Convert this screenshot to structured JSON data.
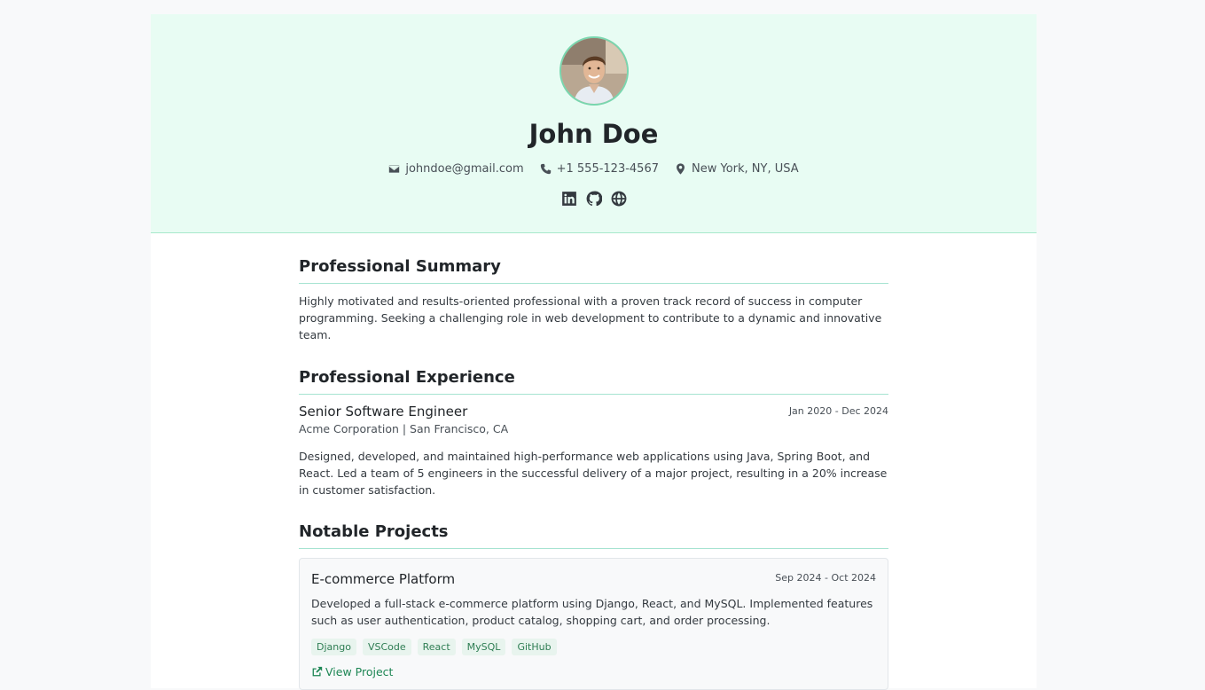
{
  "header": {
    "name": "John Doe",
    "email": "johndoe@gmail.com",
    "phone": "+1 555-123-4567",
    "location": "New York, NY, USA",
    "socials": [
      "linkedin-icon",
      "github-icon",
      "globe-icon"
    ]
  },
  "summary": {
    "title": "Professional Summary",
    "text": "Highly motivated and results-oriented professional with a proven track record of success in computer programming. Seeking a challenging role in web development to contribute to a dynamic and innovative team."
  },
  "experience": {
    "title": "Professional Experience",
    "jobs": [
      {
        "title": "Senior Software Engineer",
        "dates": "Jan 2020 - Dec 2024",
        "company": "Acme Corporation | San Francisco, CA",
        "description": "Designed, developed, and maintained high-performance web applications using Java, Spring Boot, and React. Led a team of 5 engineers in the successful delivery of a major project, resulting in a 20% increase in customer satisfaction."
      }
    ]
  },
  "projects": {
    "title": "Notable Projects",
    "items": [
      {
        "title": "E-commerce Platform",
        "dates": "Sep 2024 - Oct 2024",
        "description": "Developed a full-stack e-commerce platform using Django, React, and MySQL. Implemented features such as user authentication, product catalog, shopping cart, and order processing.",
        "tags": [
          "Django",
          "VSCode",
          "React",
          "MySQL",
          "GitHub"
        ],
        "link_label": "View Project"
      }
    ]
  },
  "colors": {
    "accent": "#1d8654",
    "header_bg": "#e8fcf3",
    "divider": "#a6e3d1"
  }
}
